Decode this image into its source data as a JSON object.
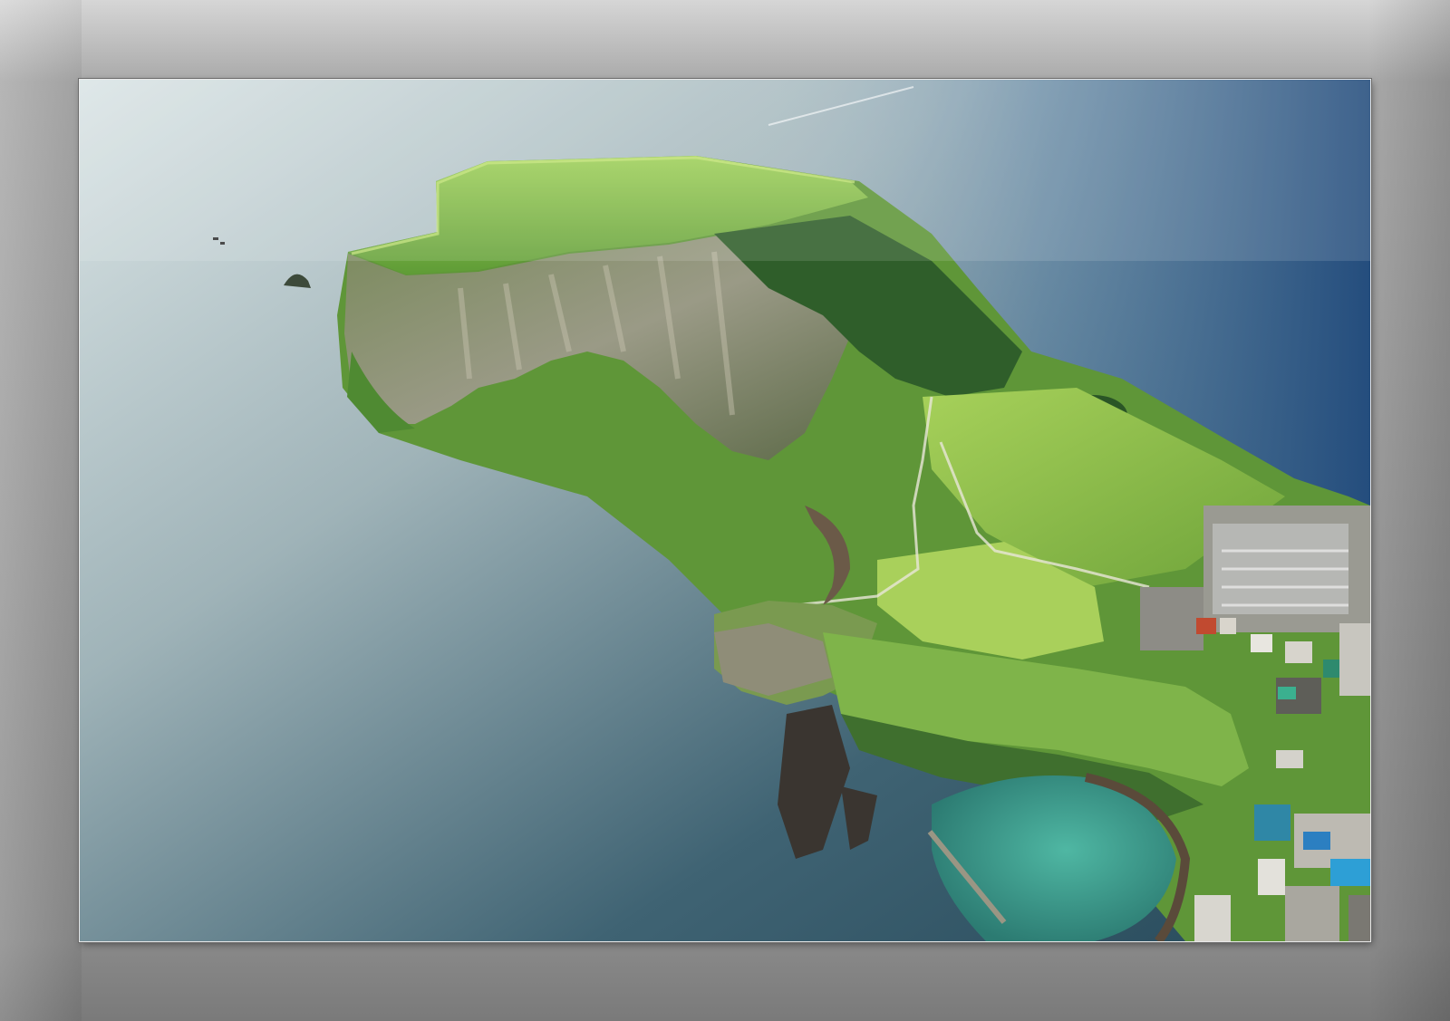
{
  "scene": {
    "colors": {
      "frame": "#9a9a9a",
      "sea_light": "#cfdcdf",
      "sea_dark": "#2b4a5c",
      "sea_right": "#2f5a86",
      "lagoon": "#3fa08f",
      "grass": "#6faa3c",
      "grass_light": "#a9cf55",
      "cliff": "#8a8a72",
      "forest": "#2f5a2a"
    }
  }
}
